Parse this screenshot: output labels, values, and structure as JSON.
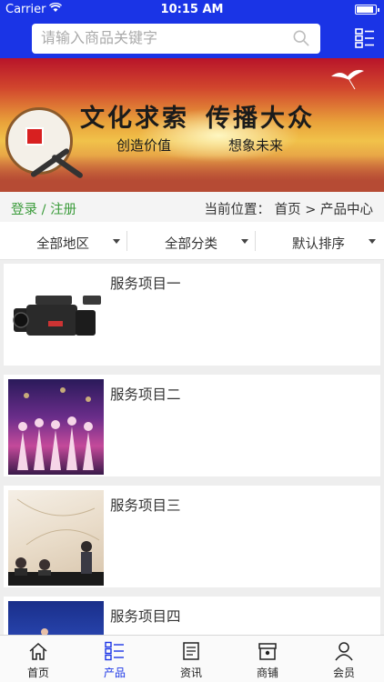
{
  "status_bar": {
    "carrier": "Carrier",
    "time": "10:15 AM",
    "battery_level": 0.9
  },
  "search": {
    "placeholder": "请输入商品关键字"
  },
  "icons": {
    "search": "search-icon",
    "menu": "list-menu-icon",
    "wifi": "wifi-icon"
  },
  "banner": {
    "title_left": "文化求索",
    "title_right": "传播大众",
    "subtitle_left": "创造价值",
    "subtitle_right": "想象未来",
    "seal_text": "田田"
  },
  "breadcrumb": {
    "login": "登录",
    "separator": "/",
    "register": "注册",
    "location": "当前位置： 首页 > 产品中心"
  },
  "filters": [
    {
      "label": "全部地区"
    },
    {
      "label": "全部分类"
    },
    {
      "label": "默认排序"
    }
  ],
  "products": [
    {
      "name": "服务项目一",
      "image": "video-camera"
    },
    {
      "name": "服务项目二",
      "image": "dance-performance"
    },
    {
      "name": "服务项目三",
      "image": "business-meeting"
    },
    {
      "name": "服务项目四",
      "image": "stage-presentation"
    }
  ],
  "tabbar": {
    "active": "产品",
    "items": [
      {
        "label": "首页",
        "icon": "home-icon"
      },
      {
        "label": "产品",
        "icon": "list-icon"
      },
      {
        "label": "资讯",
        "icon": "news-icon"
      },
      {
        "label": "商铺",
        "icon": "store-icon"
      },
      {
        "label": "会员",
        "icon": "user-icon"
      }
    ]
  },
  "colors": {
    "header": "#1a34e6",
    "login_green": "#3a9b3a",
    "tab_active": "#1a34e6"
  }
}
